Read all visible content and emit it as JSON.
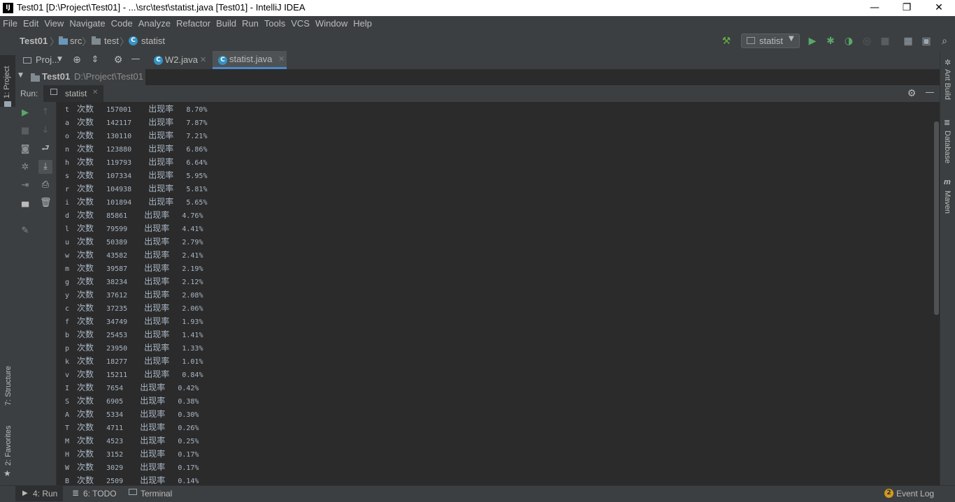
{
  "window": {
    "title": "Test01 [D:\\Project\\Test01] - ...\\src\\test\\statist.java [Test01] - IntelliJ IDEA",
    "logo": "IJ",
    "minimize": "—",
    "restore": "❐",
    "close": "✕"
  },
  "menu": [
    "File",
    "Edit",
    "View",
    "Navigate",
    "Code",
    "Analyze",
    "Refactor",
    "Build",
    "Run",
    "Tools",
    "VCS",
    "Window",
    "Help"
  ],
  "breadcrumbs": [
    "Test01",
    "src",
    "test",
    "statist"
  ],
  "run_config": "statist",
  "left_tabs": {
    "project": "1: Project",
    "structure": "7: Structure",
    "favorites": "2: Favorites"
  },
  "right_tabs": [
    "Ant Build",
    "Database",
    "Maven"
  ],
  "project_panel": {
    "label": "Proj...",
    "root_name": "Test01",
    "root_path": "D:\\Project\\Test01"
  },
  "editor_tabs": [
    {
      "label": "W2.java",
      "active": false
    },
    {
      "label": "statist.java",
      "active": true
    }
  ],
  "run_panel": {
    "label": "Run:",
    "tab": "statist"
  },
  "console_rows": [
    {
      "letter": "t",
      "count": "157001",
      "rate": "8.70%"
    },
    {
      "letter": "a",
      "count": "142117",
      "rate": "7.87%"
    },
    {
      "letter": "o",
      "count": "130110",
      "rate": "7.21%"
    },
    {
      "letter": "n",
      "count": "123880",
      "rate": "6.86%"
    },
    {
      "letter": "h",
      "count": "119793",
      "rate": "6.64%"
    },
    {
      "letter": "s",
      "count": "107334",
      "rate": "5.95%"
    },
    {
      "letter": "r",
      "count": "104938",
      "rate": "5.81%"
    },
    {
      "letter": "i",
      "count": "101894",
      "rate": "5.65%"
    },
    {
      "letter": "d",
      "count": "85861",
      "rate": "4.76%"
    },
    {
      "letter": "l",
      "count": "79599",
      "rate": "4.41%"
    },
    {
      "letter": "u",
      "count": "50389",
      "rate": "2.79%"
    },
    {
      "letter": "w",
      "count": "43582",
      "rate": "2.41%"
    },
    {
      "letter": "m",
      "count": "39587",
      "rate": "2.19%"
    },
    {
      "letter": "g",
      "count": "38234",
      "rate": "2.12%"
    },
    {
      "letter": "y",
      "count": "37612",
      "rate": "2.08%"
    },
    {
      "letter": "c",
      "count": "37235",
      "rate": "2.06%"
    },
    {
      "letter": "f",
      "count": "34749",
      "rate": "1.93%"
    },
    {
      "letter": "b",
      "count": "25453",
      "rate": "1.41%"
    },
    {
      "letter": "p",
      "count": "23950",
      "rate": "1.33%"
    },
    {
      "letter": "k",
      "count": "18277",
      "rate": "1.01%"
    },
    {
      "letter": "v",
      "count": "15211",
      "rate": "0.84%"
    },
    {
      "letter": "I",
      "count": "7654",
      "rate": "0.42%"
    },
    {
      "letter": "S",
      "count": "6905",
      "rate": "0.38%"
    },
    {
      "letter": "A",
      "count": "5334",
      "rate": "0.30%"
    },
    {
      "letter": "T",
      "count": "4711",
      "rate": "0.26%"
    },
    {
      "letter": "M",
      "count": "4523",
      "rate": "0.25%"
    },
    {
      "letter": "H",
      "count": "3152",
      "rate": "0.17%"
    },
    {
      "letter": "W",
      "count": "3029",
      "rate": "0.17%"
    },
    {
      "letter": "B",
      "count": "2509",
      "rate": "0.14%"
    }
  ],
  "console_words": {
    "times": "次数",
    "rate": "出现率"
  },
  "statusbar": {
    "run": "4: Run",
    "todo": "6: TODO",
    "terminal": "Terminal",
    "event_log": "Event Log",
    "event_count": "2"
  }
}
